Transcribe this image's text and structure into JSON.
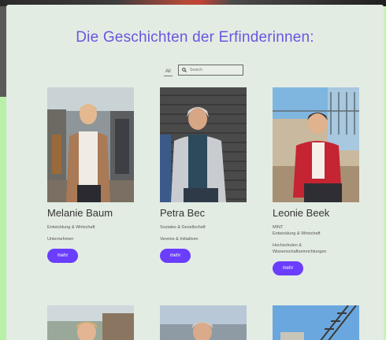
{
  "page": {
    "title": "Die Geschichten der Erfinderinnen:"
  },
  "filters": {
    "all_label": "All",
    "search_placeholder": "Search"
  },
  "inventors": [
    {
      "name": "Melanie Baum",
      "category1": "Entwicklung & Wirtschaft",
      "category2": "Unternehmen",
      "button": "mehr"
    },
    {
      "name": "Petra Bec",
      "category1": "Soziales & Gesellschaft",
      "category2": "Vereine & Initiativen",
      "button": "mehr"
    },
    {
      "name": "Leonie Beek",
      "category1a": "MINT",
      "category1b": "Entwicklung & Wirtschaft",
      "category2a": "Hochschulen &",
      "category2b": "Wissenschaftseinrichtungen",
      "button": "mehr"
    }
  ],
  "colors": {
    "accent": "#6a3dff",
    "title": "#6a55e0",
    "panel": "#e3ece3"
  }
}
